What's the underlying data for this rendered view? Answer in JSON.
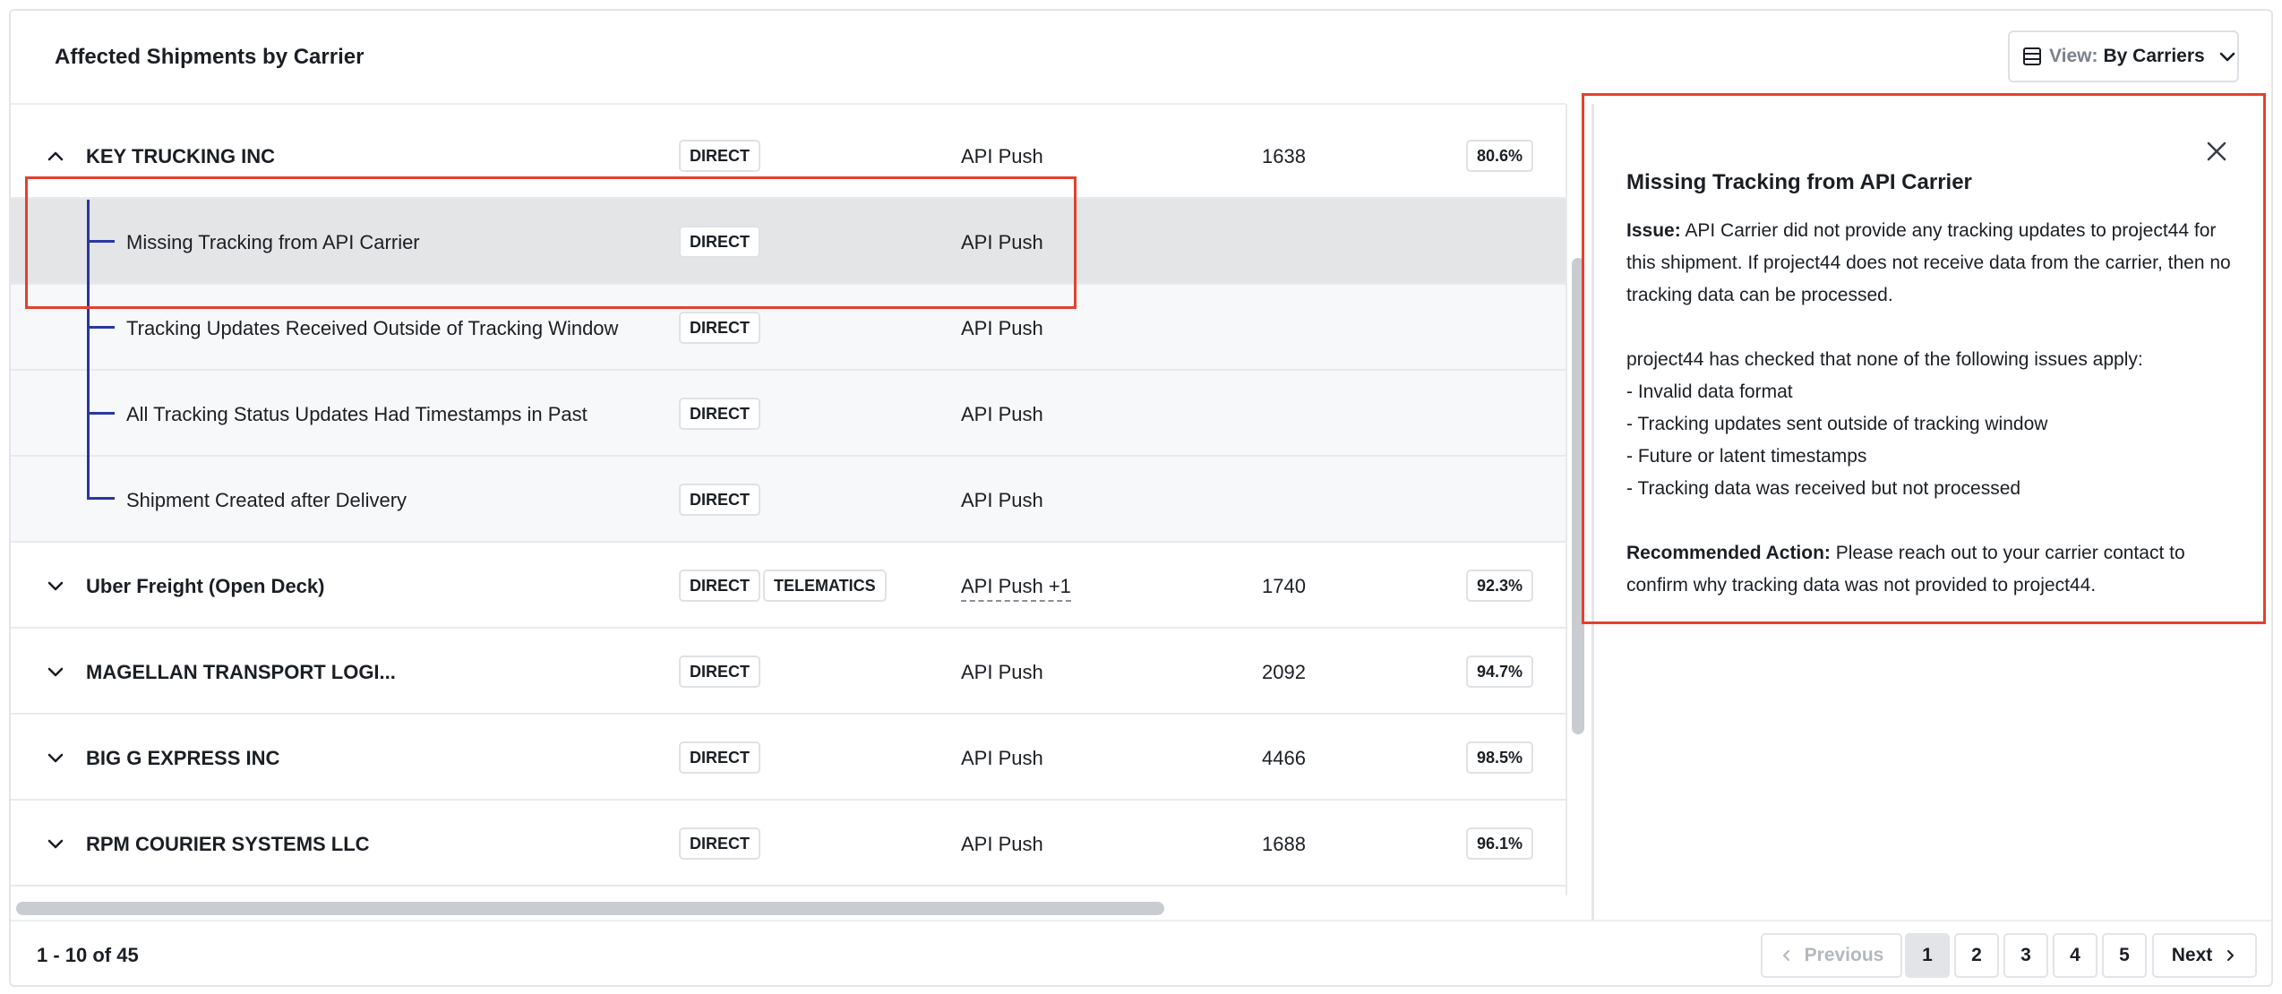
{
  "header": {
    "title": "Affected Shipments by Carrier",
    "view_label": "View:",
    "view_value": "By Carriers"
  },
  "rows": [
    {
      "type": "carrier",
      "expanded": true,
      "name": "KEY TRUCKING INC",
      "tags": [
        "DIRECT"
      ],
      "integration": "API Push",
      "count": "1638",
      "percent": "80.6%"
    },
    {
      "type": "sub",
      "selected": true,
      "name": "Missing Tracking from API Carrier",
      "tags": [
        "DIRECT"
      ],
      "integration": "API Push"
    },
    {
      "type": "sub",
      "name": "Tracking Updates Received Outside of Tracking Window",
      "tags": [
        "DIRECT"
      ],
      "integration": "API Push"
    },
    {
      "type": "sub",
      "name": "All Tracking Status Updates Had Timestamps in Past",
      "tags": [
        "DIRECT"
      ],
      "integration": "API Push"
    },
    {
      "type": "sub",
      "name": "Shipment Created after Delivery",
      "tags": [
        "DIRECT"
      ],
      "integration": "API Push"
    },
    {
      "type": "carrier",
      "expanded": false,
      "name": "Uber Freight (Open Deck)",
      "tags": [
        "DIRECT",
        "TELEMATICS"
      ],
      "integration": "API Push +1",
      "count": "1740",
      "percent": "92.3%"
    },
    {
      "type": "carrier",
      "expanded": false,
      "name": "MAGELLAN TRANSPORT LOGI...",
      "tags": [
        "DIRECT"
      ],
      "integration": "API Push",
      "count": "2092",
      "percent": "94.7%"
    },
    {
      "type": "carrier",
      "expanded": false,
      "name": "BIG G EXPRESS INC",
      "tags": [
        "DIRECT"
      ],
      "integration": "API Push",
      "count": "4466",
      "percent": "98.5%"
    },
    {
      "type": "carrier",
      "expanded": false,
      "name": "RPM COURIER SYSTEMS LLC",
      "tags": [
        "DIRECT"
      ],
      "integration": "API Push",
      "count": "1688",
      "percent": "96.1%"
    }
  ],
  "detail": {
    "title": "Missing Tracking from API Carrier",
    "issue_label": "Issue:",
    "issue_text": " API Carrier did not provide any tracking updates to project44 for this shipment. If project44 does not receive data from the carrier, then no tracking data can be processed.",
    "checked_intro": "project44 has checked that none of the following issues apply:",
    "checked_items": [
      "- Invalid data format",
      "- Tracking updates sent outside of tracking window",
      "- Future or latent timestamps",
      "- Tracking data was received but not processed"
    ],
    "action_label": "Recommended Action:",
    "action_text": " Please reach out to your carrier contact to confirm why tracking data was not provided to project44."
  },
  "pagination": {
    "range": "1 - 10 of 45",
    "previous": "Previous",
    "next": "Next",
    "pages": [
      "1",
      "2",
      "3",
      "4",
      "5"
    ],
    "current": "1"
  },
  "colors": {
    "highlight": "#e3412f",
    "tree_line": "#2a37a3",
    "selected_row": "#e4e5e7"
  }
}
